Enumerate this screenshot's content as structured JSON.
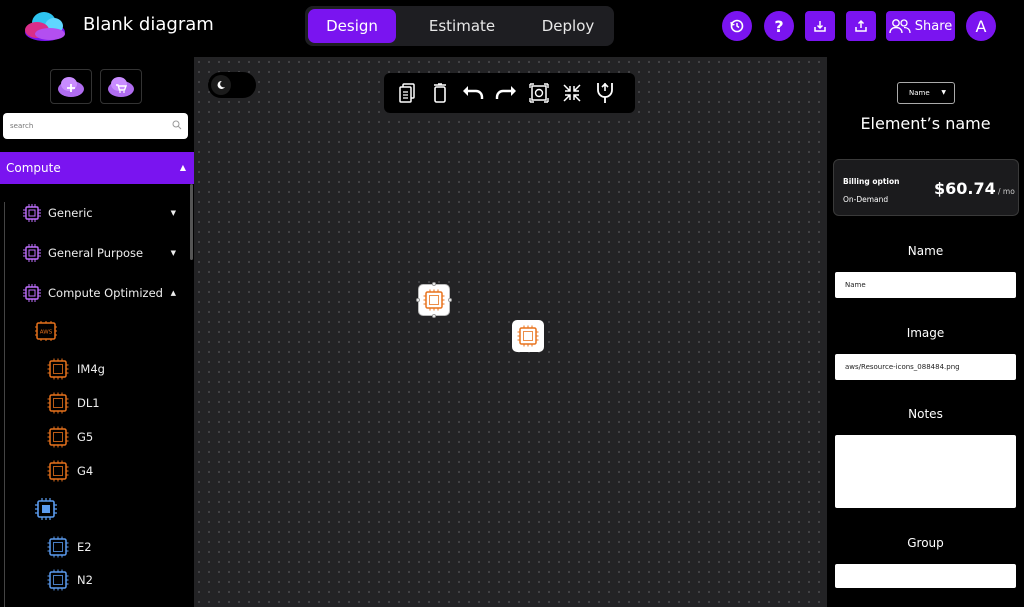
{
  "app": {
    "title": "Blank diagram",
    "brand_color": "#7a14f0"
  },
  "header": {
    "tabs": [
      {
        "label": "Design",
        "active": true
      },
      {
        "label": "Estimate",
        "active": false
      },
      {
        "label": "Deploy",
        "active": false
      }
    ],
    "share_label": "Share",
    "avatar_letter": "A",
    "icons": [
      "history-icon",
      "help-icon",
      "download-icon",
      "upload-icon",
      "users-icon"
    ]
  },
  "sidebar": {
    "search_placeholder": "search",
    "category": "Compute",
    "subcategories": [
      {
        "label": "Generic",
        "expanded": false
      },
      {
        "label": "General Purpose",
        "expanded": false
      },
      {
        "label": "Compute Optimized",
        "expanded": true
      }
    ],
    "providers": [
      {
        "provider_label": "AWS",
        "items": [
          "IM4g",
          "DL1",
          "G5",
          "G4"
        ]
      },
      {
        "provider_label": "",
        "items": [
          "E2",
          "N2"
        ]
      }
    ]
  },
  "canvas": {
    "toolbar_icons": [
      "copy-icon",
      "delete-icon",
      "undo-icon",
      "redo-icon",
      "fit-icon",
      "collapse-icon",
      "connector-icon"
    ]
  },
  "panel": {
    "name_select": "Name",
    "element_name": "Element’s name",
    "billing": {
      "label": "Billing option",
      "type": "On-Demand",
      "price": "$60.74",
      "period": "/ mo"
    },
    "fields": {
      "name_label": "Name",
      "name_value": "Name",
      "image_label": "Image",
      "image_value": "aws/Resource-icons_088484.png",
      "notes_label": "Notes",
      "notes_value": "",
      "group_label": "Group",
      "group_value": ""
    }
  }
}
